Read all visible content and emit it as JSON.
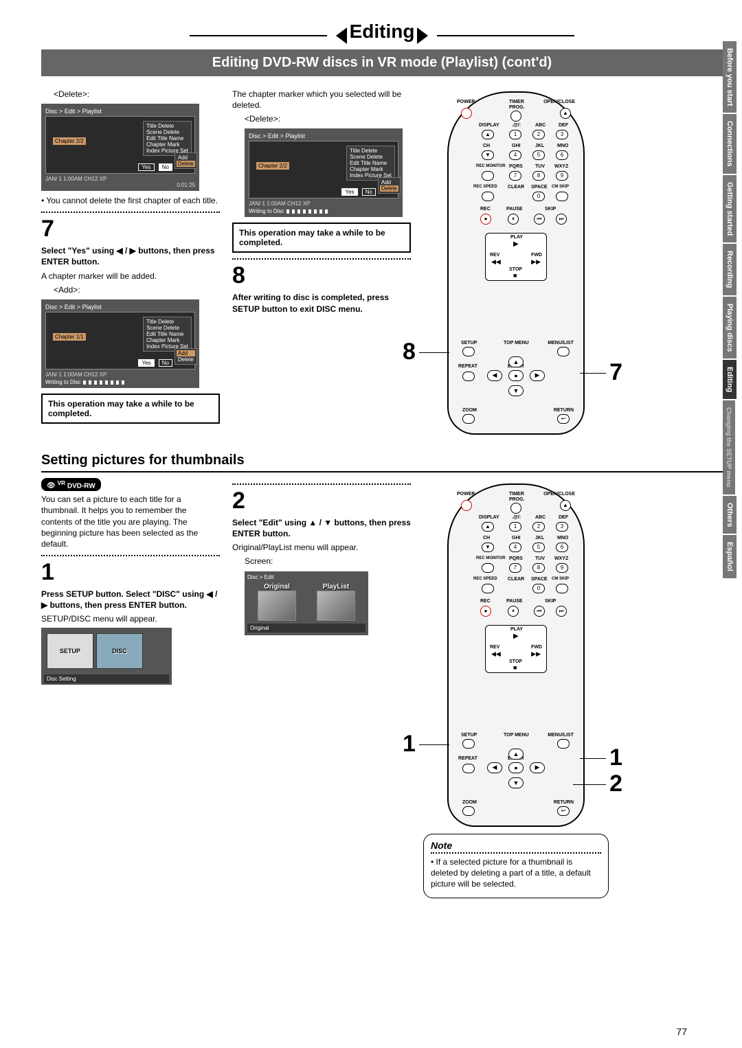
{
  "header": {
    "title": "Editing",
    "subtitle": "Editing DVD-RW discs in VR mode (Playlist) (cont'd)"
  },
  "page_number": "77",
  "side_tabs": [
    "Before you start",
    "Connections",
    "Getting started",
    "Recording",
    "Playing discs",
    "Editing",
    "Changing the SETUP menu",
    "Others",
    "Español"
  ],
  "side_tabs_active_index": 5,
  "col1": {
    "delete_label": "<Delete>:",
    "osd1": {
      "breadcrumb": "Disc > Edit > Playlist",
      "menu": [
        "Title Delete",
        "Scene Delete",
        "Edit Title Name",
        "Chapter Mark",
        "Index Picture Set"
      ],
      "submenu": [
        "Add",
        "Delete"
      ],
      "submenu_sel": 1,
      "chapter": "Chapter 2/2",
      "yes": "Yes",
      "no": "No",
      "yn_sel": "no",
      "footer": "JAN/ 1   1:00AM  CH12     XP",
      "time": "0:01:25"
    },
    "note1": "• You cannot delete the first chapter of each title.",
    "step7": "7",
    "step7_bold": "Select \"Yes\" using ◀ / ▶ buttons, then press ENTER button.",
    "step7_text": "A chapter marker will be added.",
    "add_label": "<Add>:",
    "osd2": {
      "breadcrumb": "Disc > Edit > Playlist",
      "menu": [
        "Title Delete",
        "Scene Delete",
        "Edit Title Name",
        "Chapter Mark",
        "Index Picture Set"
      ],
      "submenu": [
        "Add",
        "Delete"
      ],
      "submenu_sel": 0,
      "chapter": "Chapter 1/1",
      "yes": "Yes",
      "no": "No",
      "yn_sel": "yes",
      "footer": "JAN/ 1   1:00AM  CH12     XP",
      "writing": "Writing to Disc"
    },
    "warn": "This operation may take a while to be completed."
  },
  "col2": {
    "intro": "The chapter marker which you selected will be deleted.",
    "delete_label": "<Delete>:",
    "osd3": {
      "breadcrumb": "Disc > Edit > Playlist",
      "menu": [
        "Title Delete",
        "Scene Delete",
        "Edit Title Name",
        "Chapter Mark",
        "Index Picture Set"
      ],
      "submenu": [
        "Add",
        "Delete"
      ],
      "submenu_sel": 1,
      "chapter": "Chapter 2/2",
      "yes": "Yes",
      "no": "No",
      "yn_sel": "yes",
      "footer": "JAN/ 1   1:00AM  CH12     XP",
      "writing": "Writing to Disc"
    },
    "warn": "This operation may take a while to be completed.",
    "step8": "8",
    "step8_bold": "After writing to disc is completed, press SETUP button to exit DISC menu."
  },
  "section2": {
    "title": "Setting pictures for thumbnails",
    "badge": "DVD-RW",
    "badge_sup": "VR",
    "intro": "You can set a picture to each title for a thumbnail. It helps you to remember the contents of the title you are playing. The beginning picture has been selected as the default.",
    "step1": "1",
    "step1_bold": "Press SETUP button. Select \"DISC\" using ◀ / ▶ buttons, then press ENTER button.",
    "step1_text": "SETUP/DISC menu will appear.",
    "setup_osd": {
      "setup": "SETUP",
      "disc": "DISC",
      "footer": "Disc Setting"
    },
    "step2": "2",
    "step2_bold": "Select \"Edit\" using ▲ / ▼ buttons, then press ENTER button.",
    "step2_text": "Original/PlayList menu will appear.",
    "screen_label": "Screen:",
    "edit_osd": {
      "breadcrumb": "Disc > Edit",
      "original": "Original",
      "playlist": "PlayList",
      "footer": "Original"
    },
    "note_title": "Note",
    "note_body": "• If a selected picture for a thumbnail is deleted by deleting a part of a title, a default picture will be selected."
  },
  "remote": {
    "power": "POWER",
    "openclose": "OPEN/CLOSE",
    "timer": "TIMER",
    "prog": "PROG.",
    "display": "DISPLAY",
    "abc": "ABC",
    "def": "DEF",
    "ghi": "GHI",
    "jkl": "JKL",
    "mno": "MNO",
    "pqrs": "PQRS",
    "tuv": "TUV",
    "wxyz": "WXYZ",
    "ch": "CH",
    "recmon": "REC MONITOR",
    "recspeed": "REC SPEED",
    "clear": "CLEAR",
    "space": "SPACE",
    "cmskip": "CM SKIP",
    "rec": "REC",
    "pause": "PAUSE",
    "skip": "SKIP",
    "play": "PLAY",
    "rev": "REV",
    "fwd": "FWD",
    "stop": "STOP",
    "setup": "SETUP",
    "topmenu": "TOP MENU",
    "menulist": "MENU/LIST",
    "repeat": "REPEAT",
    "enter": "ENTER",
    "return": "RETURN",
    "zoom": "ZOOM",
    "at": ".@/:",
    "nums": [
      "1",
      "2",
      "3",
      "4",
      "5",
      "6",
      "7",
      "8",
      "9",
      "0"
    ]
  },
  "callouts_top": {
    "c8": "8",
    "c7": "7"
  },
  "callouts_bot": {
    "c1": "1",
    "c1r": "1",
    "c2": "2"
  }
}
